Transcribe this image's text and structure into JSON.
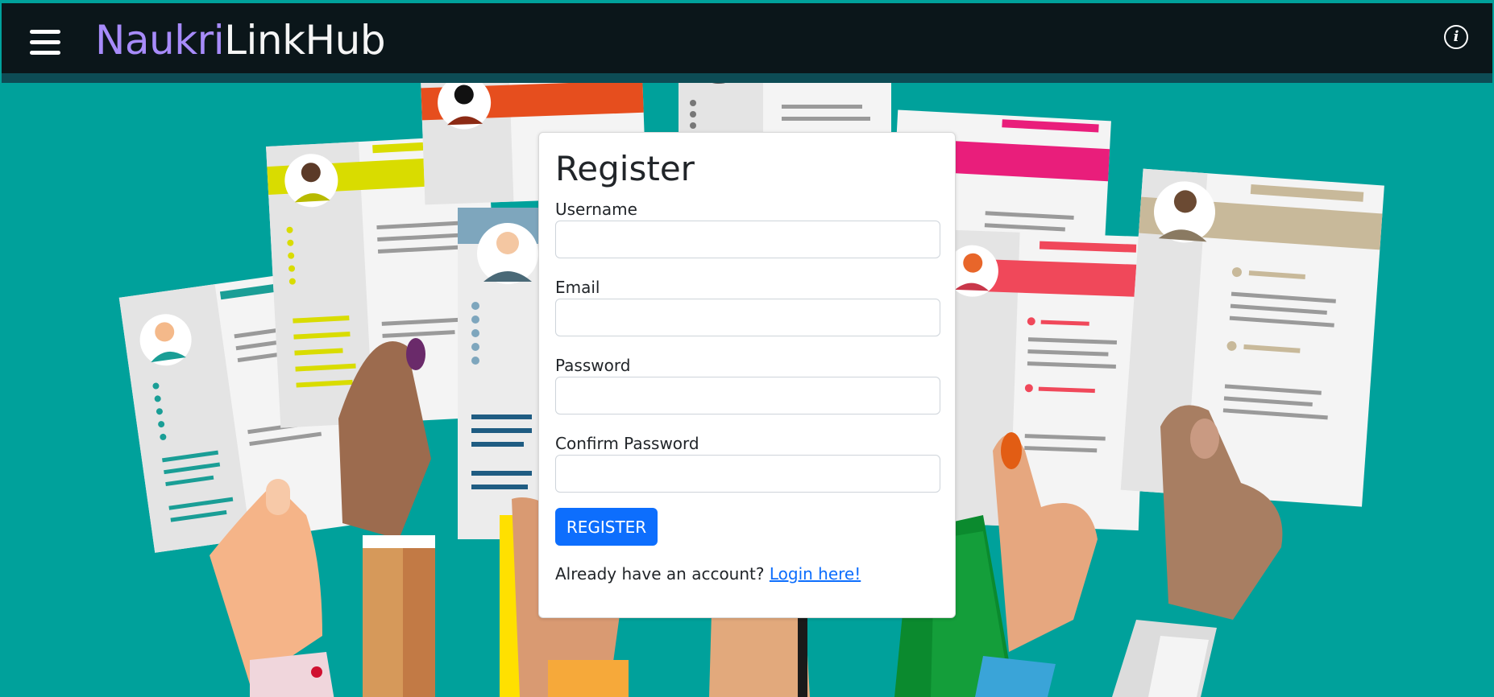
{
  "colors": {
    "background": "#00a19b",
    "navbar": "#0b161a",
    "brand_accent": "#a78bfa",
    "brand_text": "#f5f5f5",
    "primary": "#0d6efd"
  },
  "navbar": {
    "menu_icon": "hamburger-menu-icon",
    "brand_part1": "Naukri",
    "brand_part2": "LinkHub",
    "info_icon": "info-icon",
    "info_glyph": "i"
  },
  "background_image": "hands-holding-resumes-illustration",
  "form": {
    "title": "Register",
    "fields": [
      {
        "label": "Username",
        "value": "",
        "placeholder": ""
      },
      {
        "label": "Email",
        "value": "",
        "placeholder": ""
      },
      {
        "label": "Password",
        "value": "",
        "placeholder": ""
      },
      {
        "label": "Confirm Password",
        "value": "",
        "placeholder": ""
      }
    ],
    "submit_label": "REGISTER",
    "login_prompt": "Already have an account?",
    "login_link": "Login here!"
  }
}
